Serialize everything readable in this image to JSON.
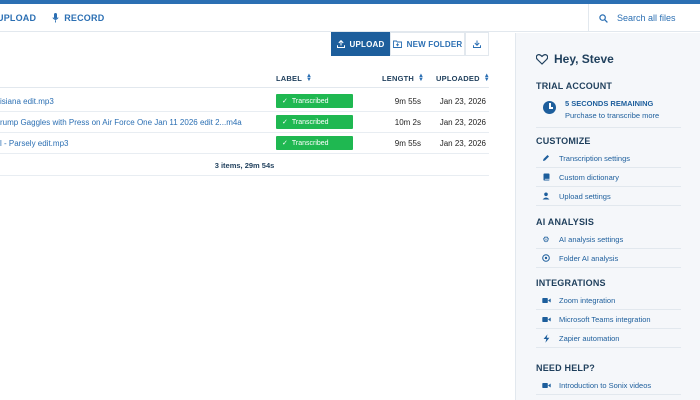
{
  "topnav": {
    "upload_label": "UPLOAD",
    "record_label": "RECORD"
  },
  "search": {
    "placeholder": "Search all files"
  },
  "toolbar": {
    "upload_label": "UPLOAD",
    "new_folder_label": "NEW FOLDER"
  },
  "table": {
    "headers": {
      "label": "LABEL",
      "length": "LENGTH",
      "uploaded": "UPLOADED"
    },
    "rows": [
      {
        "name": "isiana edit.mp3",
        "label": "Transcribed",
        "length": "9m 55s",
        "uploaded": "Jan 23, 2026"
      },
      {
        "name": "rump Gaggles with Press on Air Force One Jan 11 2026 edit 2...m4a",
        "label": "Transcribed",
        "length": "10m 2s",
        "uploaded": "Jan 23, 2026"
      },
      {
        "name": "l - Parsely edit.mp3",
        "label": "Transcribed",
        "length": "9m 55s",
        "uploaded": "Jan 23, 2026"
      }
    ],
    "summary": "3 items, 29m 54s"
  },
  "sidebar": {
    "greeting": "Hey, Steve",
    "trial": {
      "title": "TRIAL ACCOUNT",
      "remaining": "5 SECONDS REMAINING",
      "cta": "Purchase to transcribe more"
    },
    "customize": {
      "title": "CUSTOMIZE",
      "items": [
        "Transcription settings",
        "Custom dictionary",
        "Upload settings"
      ]
    },
    "ai_analysis": {
      "title": "AI ANALYSIS",
      "items": [
        "AI analysis settings",
        "Folder AI analysis"
      ]
    },
    "integrations": {
      "title": "INTEGRATIONS",
      "items": [
        "Zoom integration",
        "Microsoft Teams integration",
        "Zapier automation"
      ]
    },
    "help": {
      "title": "NEED HELP?",
      "items": [
        "Introduction to Sonix videos"
      ]
    }
  },
  "colors": {
    "brand_blue": "#2b6fb3",
    "primary_button": "#1d5e9c",
    "badge_green": "#1fb851",
    "sidebar_bg": "#f5f7fa"
  }
}
